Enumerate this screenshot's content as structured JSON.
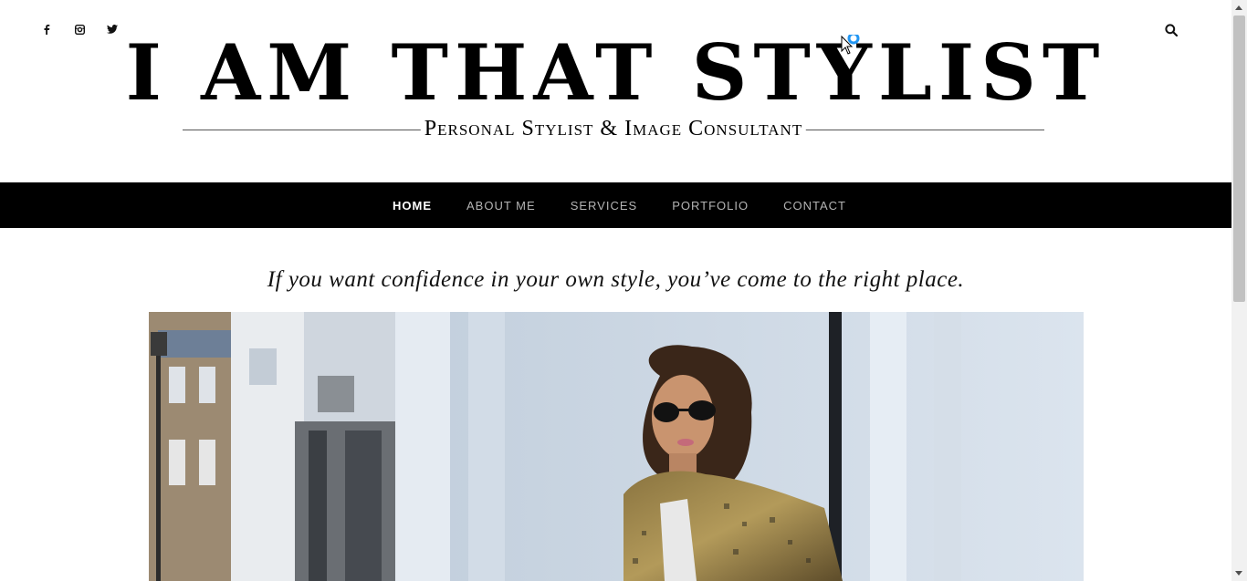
{
  "social": {
    "facebook_icon": "facebook-icon",
    "instagram_icon": "instagram-icon",
    "twitter_icon": "twitter-icon"
  },
  "search": {
    "icon": "search-icon"
  },
  "header": {
    "title": "I AM THAT STYLIST",
    "tagline": "Personal Stylist & Image Consultant"
  },
  "nav": {
    "items": [
      {
        "label": "HOME",
        "active": true
      },
      {
        "label": "ABOUT ME",
        "active": false
      },
      {
        "label": "SERVICES",
        "active": false
      },
      {
        "label": "PORTFOLIO",
        "active": false
      },
      {
        "label": "CONTACT",
        "active": false
      }
    ]
  },
  "main": {
    "intro": "If you want confidence in your own style, you’ve come to the right place."
  },
  "colors": {
    "nav_bg": "#000000",
    "nav_text": "#b4b4b4",
    "nav_active": "#ffffff",
    "cursor_indicator": "#2196f3"
  }
}
